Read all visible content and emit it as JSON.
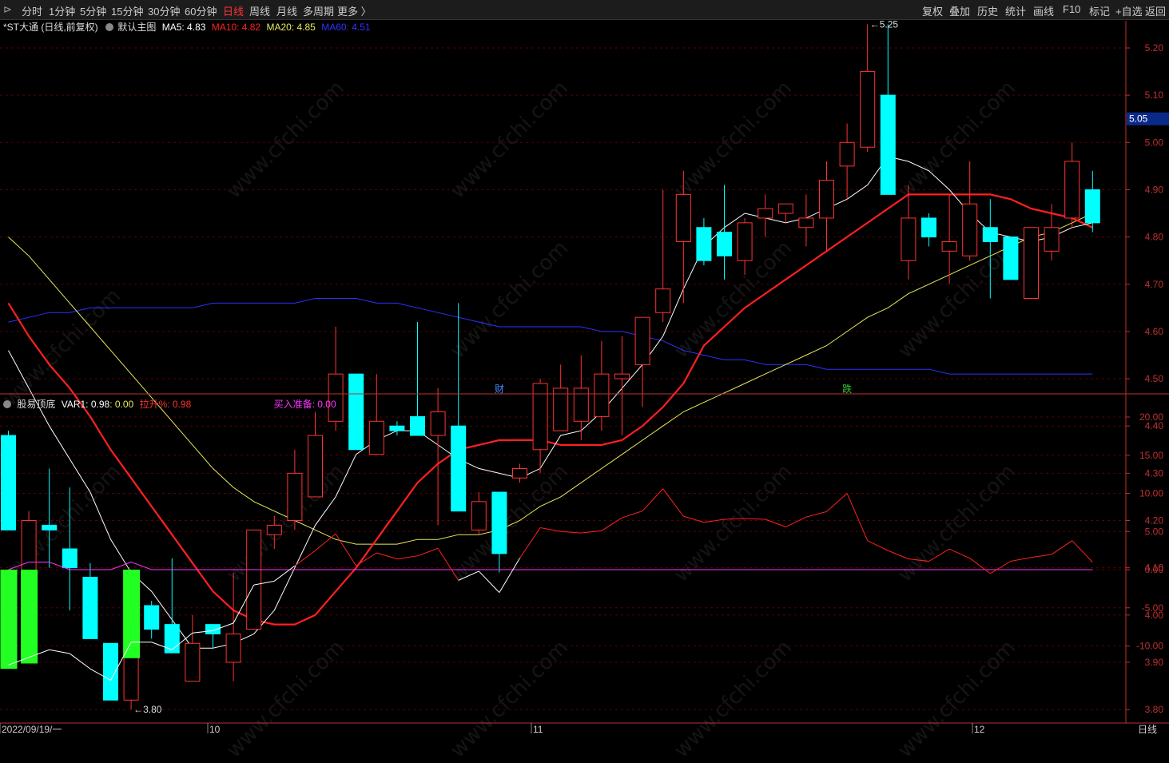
{
  "toolbar": {
    "periods": [
      "分时",
      "1分钟",
      "5分钟",
      "15分钟",
      "30分钟",
      "60分钟",
      "日线",
      "周线",
      "月线",
      "多周期",
      "更多 〉"
    ],
    "active_period": "日线",
    "right": [
      "复权",
      "叠加",
      "历史",
      "统计",
      "画线",
      "F10",
      "标记",
      "+自选",
      "返回"
    ]
  },
  "main_legend": {
    "stock": "*ST大通 (日线,前复权)",
    "template": "默认主图",
    "ma5": "MA5: 4.83",
    "ma10": "MA10: 4.82",
    "ma20": "MA20: 4.85",
    "ma60": "MA60: 4.51"
  },
  "sub_legend": {
    "name": "股易顶底",
    "var1": "VAR1: 0.98",
    "zero": ": 0.00",
    "rise": "拉升%: 0.98",
    "buy": "买入准备: 0.00"
  },
  "colors": {
    "up": "#ff3333",
    "down": "#00ffff",
    "ma5": "#ffffff",
    "ma10": "#ff2020",
    "ma20": "#e8e85a",
    "ma60": "#3030ff",
    "buy_bar": "#22ff22",
    "grid": "#5a0000",
    "axis": "#c03030"
  },
  "markers": {
    "high": "5.25",
    "low": "3.80",
    "last_price": "5.05",
    "event1": "财",
    "event2": "跌"
  },
  "x_axis": {
    "start": "2022/09/19/一",
    "m10": "10",
    "m11": "11",
    "m12": "12",
    "period": "日线"
  },
  "watermark": "www.cfchi.com",
  "chart_data": [
    {
      "type": "candlestick",
      "y_ticks": [
        5.2,
        5.1,
        5.0,
        4.9,
        4.8,
        4.7,
        4.6,
        4.5,
        4.4,
        4.3,
        4.2,
        4.1,
        4.0,
        3.9,
        3.8
      ],
      "ylim": [
        3.76,
        5.29
      ],
      "candles": [
        [
          4.38,
          4.39,
          4.18,
          4.18
        ],
        [
          4.01,
          4.22,
          4.0,
          4.2
        ],
        [
          4.19,
          4.31,
          4.1,
          4.18
        ],
        [
          4.14,
          4.27,
          4.01,
          4.1
        ],
        [
          4.08,
          4.11,
          3.95,
          3.95
        ],
        [
          3.94,
          3.94,
          3.82,
          3.82
        ],
        [
          3.82,
          4.0,
          3.8,
          4.0
        ],
        [
          4.02,
          4.03,
          3.95,
          3.97
        ],
        [
          3.98,
          4.12,
          3.92,
          3.92
        ],
        [
          3.86,
          4.0,
          3.86,
          3.94
        ],
        [
          3.98,
          3.98,
          3.93,
          3.96
        ],
        [
          3.9,
          4.09,
          3.86,
          3.96
        ],
        [
          3.97,
          4.18,
          3.97,
          4.18
        ],
        [
          4.17,
          4.21,
          4.14,
          4.19
        ],
        [
          4.2,
          4.35,
          4.18,
          4.3
        ],
        [
          4.25,
          4.43,
          4.25,
          4.38
        ],
        [
          4.41,
          4.61,
          4.39,
          4.51
        ],
        [
          4.51,
          4.51,
          4.35,
          4.35
        ],
        [
          4.34,
          4.51,
          4.34,
          4.41
        ],
        [
          4.4,
          4.41,
          4.38,
          4.39
        ],
        [
          4.42,
          4.62,
          4.38,
          4.38
        ],
        [
          4.38,
          4.48,
          4.19,
          4.43
        ],
        [
          4.4,
          4.66,
          4.22,
          4.22
        ],
        [
          4.18,
          4.26,
          4.17,
          4.24
        ],
        [
          4.26,
          4.26,
          4.09,
          4.13
        ],
        [
          4.29,
          4.32,
          4.28,
          4.31
        ],
        [
          4.35,
          4.5,
          4.3,
          4.49
        ],
        [
          4.39,
          4.53,
          4.39,
          4.48
        ],
        [
          4.41,
          4.55,
          4.37,
          4.48
        ],
        [
          4.42,
          4.58,
          4.39,
          4.51
        ],
        [
          4.5,
          4.59,
          4.38,
          4.51
        ],
        [
          4.53,
          4.63,
          4.44,
          4.63
        ],
        [
          4.64,
          4.9,
          4.62,
          4.69
        ],
        [
          4.79,
          4.94,
          4.66,
          4.89
        ],
        [
          4.82,
          4.84,
          4.74,
          4.75
        ],
        [
          4.81,
          4.91,
          4.71,
          4.76
        ],
        [
          4.75,
          4.84,
          4.72,
          4.83
        ],
        [
          4.84,
          4.89,
          4.8,
          4.86
        ],
        [
          4.85,
          4.87,
          4.83,
          4.87
        ],
        [
          4.82,
          4.89,
          4.78,
          4.84
        ],
        [
          4.84,
          4.96,
          4.77,
          4.92
        ],
        [
          4.95,
          5.04,
          4.88,
          5.0
        ],
        [
          4.99,
          5.25,
          4.98,
          5.15
        ],
        [
          5.1,
          5.25,
          4.89,
          4.89
        ],
        [
          4.75,
          4.91,
          4.71,
          4.84
        ],
        [
          4.84,
          4.85,
          4.78,
          4.8
        ],
        [
          4.77,
          4.89,
          4.7,
          4.79
        ],
        [
          4.76,
          4.96,
          4.75,
          4.87
        ],
        [
          4.82,
          4.88,
          4.67,
          4.79
        ],
        [
          4.8,
          4.8,
          4.71,
          4.71
        ],
        [
          4.67,
          4.82,
          4.67,
          4.82
        ],
        [
          4.77,
          4.87,
          4.75,
          4.82
        ],
        [
          4.84,
          5.0,
          4.82,
          4.96
        ],
        [
          4.9,
          4.94,
          4.81,
          4.83
        ]
      ],
      "series": [
        {
          "name": "MA5",
          "values": [
            4.56,
            4.48,
            4.4,
            4.33,
            4.26,
            4.16,
            4.09,
            4.05,
            3.99,
            3.93,
            3.93,
            3.94,
            3.96,
            4.01,
            4.1,
            4.19,
            4.25,
            4.34,
            4.37,
            4.39,
            4.39,
            4.36,
            4.33,
            4.31,
            4.3,
            4.29,
            4.31,
            4.38,
            4.39,
            4.43,
            4.48,
            4.53,
            4.59,
            4.69,
            4.78,
            4.82,
            4.85,
            4.84,
            4.83,
            4.84,
            4.86,
            4.88,
            4.91,
            4.97,
            4.96,
            4.94,
            4.9,
            4.85,
            4.81,
            4.8,
            4.79,
            4.8,
            4.82,
            4.83
          ]
        },
        {
          "name": "MA10",
          "values": [
            4.66,
            4.59,
            4.53,
            4.48,
            4.42,
            4.35,
            4.29,
            4.23,
            4.17,
            4.11,
            4.05,
            4.01,
            3.99,
            3.98,
            3.98,
            4.0,
            4.05,
            4.1,
            4.16,
            4.22,
            4.28,
            4.32,
            4.35,
            4.36,
            4.37,
            4.37,
            4.37,
            4.36,
            4.36,
            4.36,
            4.37,
            4.4,
            4.44,
            4.49,
            4.57,
            4.61,
            4.65,
            4.68,
            4.71,
            4.74,
            4.77,
            4.8,
            4.83,
            4.86,
            4.89,
            4.89,
            4.89,
            4.89,
            4.89,
            4.88,
            4.86,
            4.85,
            4.84,
            4.82
          ]
        },
        {
          "name": "MA20",
          "values": [
            4.8,
            4.76,
            4.71,
            4.66,
            4.61,
            4.56,
            4.51,
            4.46,
            4.41,
            4.36,
            4.31,
            4.27,
            4.24,
            4.22,
            4.2,
            4.18,
            4.16,
            4.15,
            4.15,
            4.15,
            4.16,
            4.16,
            4.17,
            4.17,
            4.18,
            4.2,
            4.23,
            4.25,
            4.28,
            4.31,
            4.34,
            4.37,
            4.4,
            4.43,
            4.45,
            4.47,
            4.49,
            4.51,
            4.53,
            4.55,
            4.57,
            4.6,
            4.63,
            4.65,
            4.68,
            4.7,
            4.72,
            4.74,
            4.76,
            4.78,
            4.8,
            4.81,
            4.83,
            4.85
          ]
        },
        {
          "name": "MA60",
          "values": [
            4.62,
            4.63,
            4.64,
            4.64,
            4.65,
            4.65,
            4.65,
            4.65,
            4.65,
            4.65,
            4.66,
            4.66,
            4.66,
            4.66,
            4.66,
            4.67,
            4.67,
            4.67,
            4.66,
            4.66,
            4.65,
            4.64,
            4.63,
            4.62,
            4.61,
            4.61,
            4.61,
            4.61,
            4.61,
            4.6,
            4.6,
            4.59,
            4.58,
            4.56,
            4.55,
            4.54,
            4.54,
            4.53,
            4.53,
            4.53,
            4.52,
            4.52,
            4.52,
            4.52,
            4.52,
            4.52,
            4.51,
            4.51,
            4.51,
            4.51,
            4.51,
            4.51,
            4.51,
            4.51
          ]
        }
      ]
    },
    {
      "type": "line",
      "y_ticks": [
        20.0,
        15.0,
        10.0,
        5.0,
        0.0,
        -5.0,
        -10.0
      ],
      "ylim": [
        -19.5,
        23.5
      ],
      "series": [
        {
          "name": "VAR1",
          "values": [
            -12.5,
            -11.5,
            -10.5,
            -11,
            -13,
            -14.5,
            -9.5,
            -9.5,
            -10.5,
            -8.3,
            -8,
            -7,
            -2,
            -1.5,
            0.5,
            2.5,
            4.7,
            0.5,
            2.2,
            1.4,
            1.8,
            2.8,
            -1.4,
            -0.2,
            -3,
            1.5,
            5.5,
            5,
            4.8,
            5.1,
            6.8,
            7.7,
            10.6,
            7,
            6.2,
            6.6,
            6.7,
            6.6,
            5.6,
            6.9,
            7.6,
            10,
            3.8,
            2.5,
            1.4,
            1.1,
            2.7,
            1.5,
            -0.5,
            1.1,
            1.6,
            2,
            3.8,
            0.98
          ]
        },
        {
          "name": "买入准备",
          "values": [
            -13,
            -12.3,
            0,
            0,
            0,
            0,
            -11.6,
            0,
            0,
            0,
            0,
            0,
            0,
            0,
            0,
            0,
            0,
            0,
            0,
            0,
            0,
            0,
            0,
            0,
            0,
            0,
            0,
            0,
            0,
            0,
            0,
            0,
            0,
            0,
            0,
            0,
            0,
            0,
            0,
            0,
            0,
            0,
            0,
            0,
            0,
            0,
            0,
            0,
            0,
            0,
            0,
            0,
            0,
            0
          ]
        }
      ]
    }
  ]
}
